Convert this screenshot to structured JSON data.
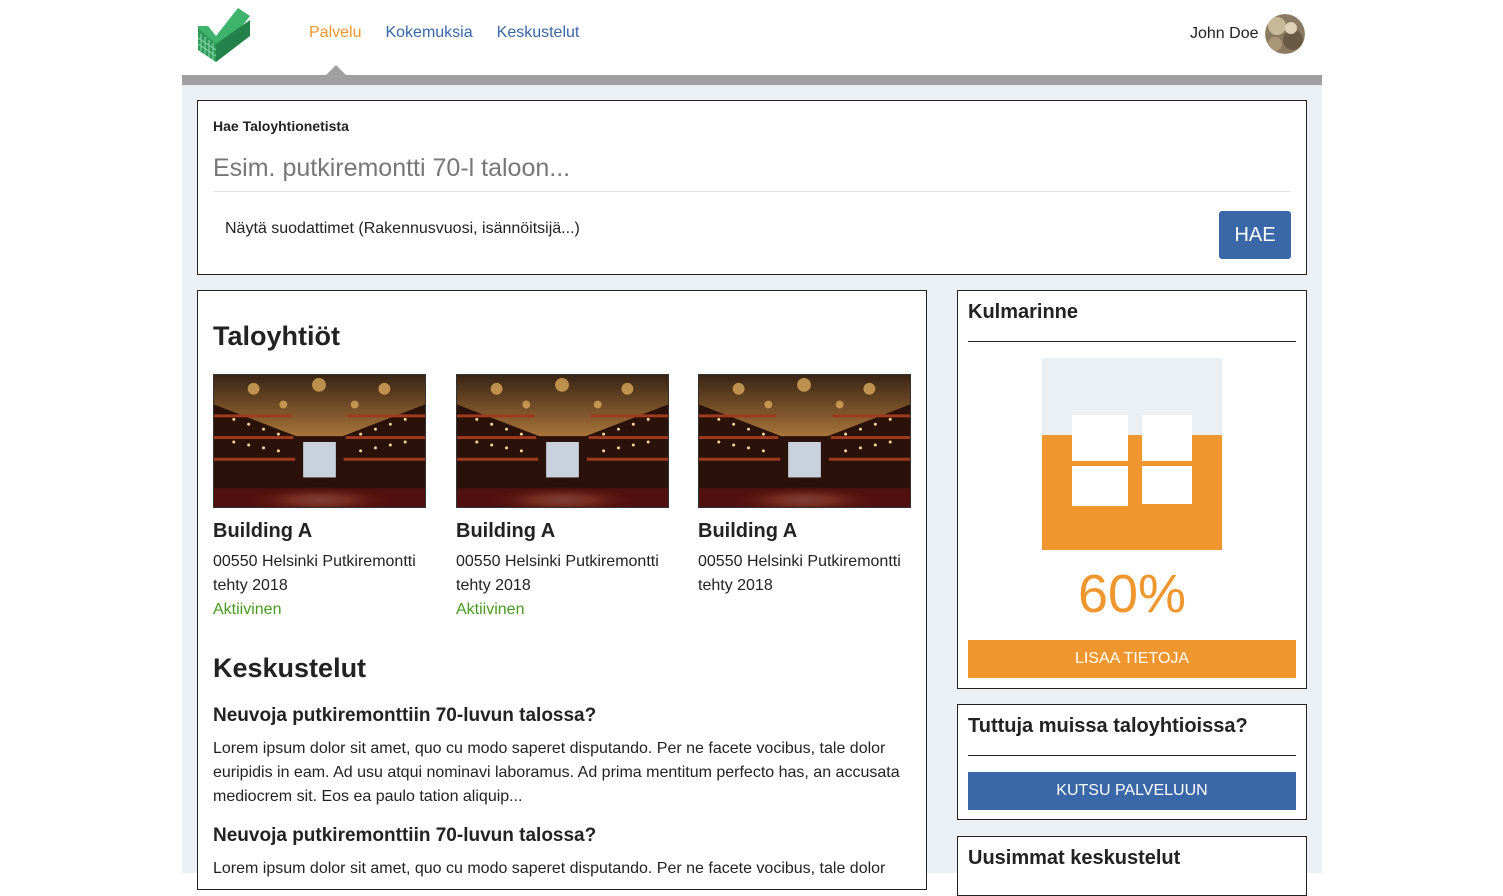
{
  "header": {
    "logo_icon": "checkmark-building-logo",
    "nav": [
      {
        "label": "Palvelu",
        "active": true
      },
      {
        "label": "Kokemuksia",
        "active": false
      },
      {
        "label": "Keskustelut",
        "active": false
      }
    ],
    "user_name": "John Doe"
  },
  "search": {
    "label": "Hae Taloyhtionetista",
    "placeholder": "Esim. putkiremontti 70-l taloon...",
    "filters_label": "Näytä suodattimet (Rakennusvuosi, isännöitsijä...)",
    "button_label": "HAE"
  },
  "main": {
    "buildings_title": "Taloyhtiöt",
    "buildings": [
      {
        "name": "Building A",
        "desc": "00550 Helsinki Putkiremontti tehty 2018",
        "status": "Aktiivinen"
      },
      {
        "name": "Building A",
        "desc": "00550 Helsinki Putkiremontti tehty 2018",
        "status": "Aktiivinen"
      },
      {
        "name": "Building A",
        "desc": "00550 Helsinki Putkiremontti tehty 2018",
        "status": ""
      }
    ],
    "discussions_title": "Keskustelut",
    "threads": [
      {
        "title": "Neuvoja putkiremonttiin 70-luvun talossa?",
        "body": "Lorem ipsum dolor sit amet, quo cu modo saperet disputando. Per ne facete vocibus, tale dolor euripidis in eam. Ad usu atqui nominavi laboramus. Ad prima mentitum perfecto has, an accusata mediocrem sit. Eos ea paulo tation aliquip..."
      },
      {
        "title": "Neuvoja putkiremonttiin 70-luvun talossa?",
        "body": "Lorem ipsum dolor sit amet, quo cu modo saperet disputando. Per ne facete vocibus, tale dolor"
      }
    ]
  },
  "sidebar": {
    "kulmarinne": {
      "title": "Kulmarinne",
      "progress_text": "60%",
      "progress_fraction": 0.6,
      "button_label": "LISAA TIETOJA"
    },
    "invite": {
      "title": "Tuttuja muissa taloyhtioissa?",
      "button_label": "KUTSU PALVELUUN"
    },
    "latest": {
      "title": "Uusimmat keskustelut"
    }
  },
  "colors": {
    "accent_orange": "#f0962f",
    "primary_blue": "#3a67a8",
    "status_green": "#4a9a22",
    "logo_green": "#3db36b",
    "page_bg": "#ebf0f4"
  }
}
